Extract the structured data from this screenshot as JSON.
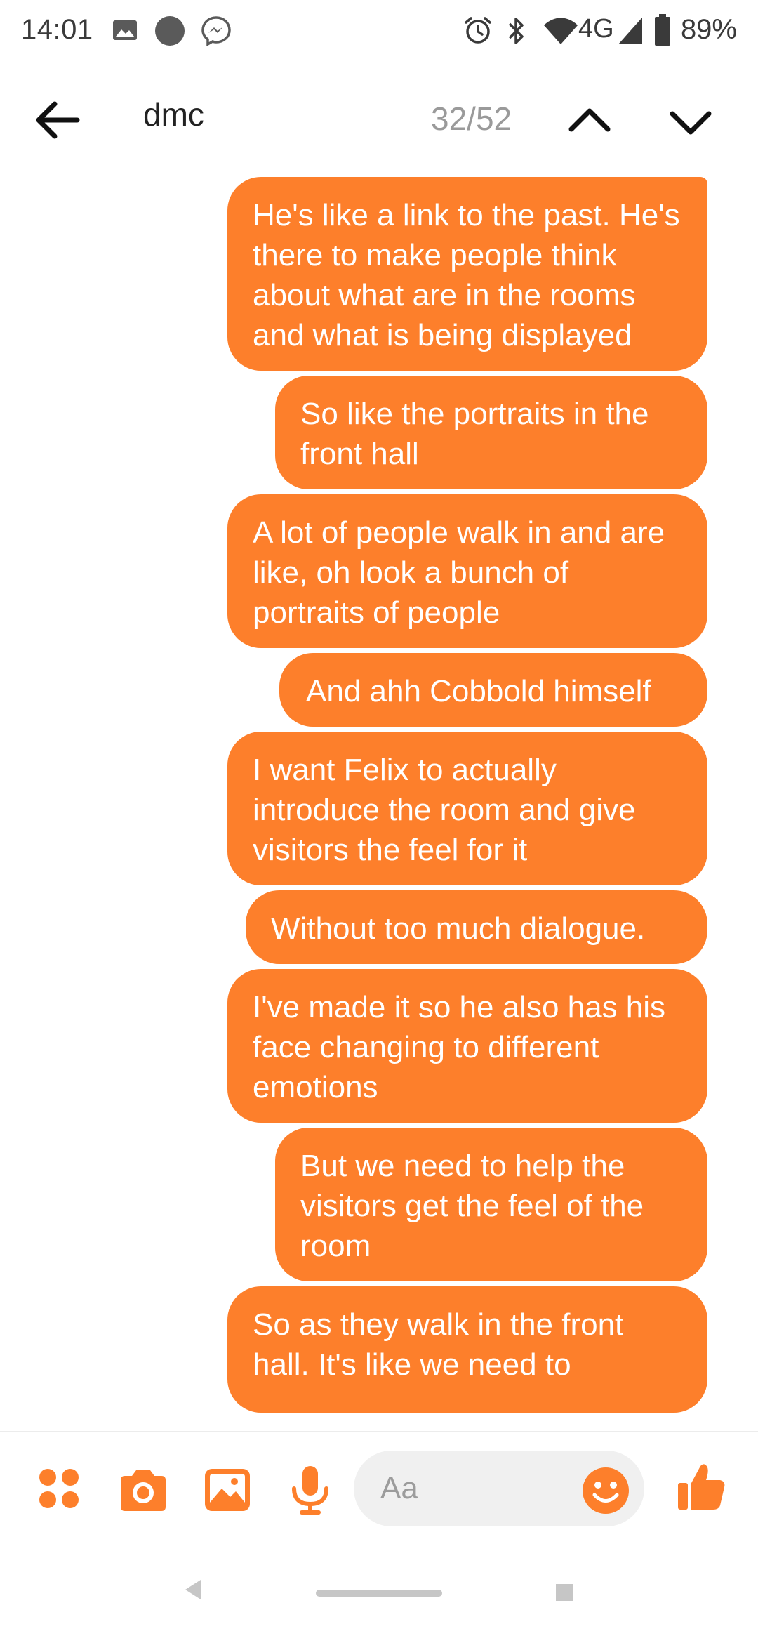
{
  "status_bar": {
    "time": "14:01",
    "network": "4G",
    "battery_percent": "89%",
    "icons": [
      "image-icon",
      "dot-icon",
      "messenger-icon",
      "alarm-icon",
      "bluetooth-icon",
      "wifi-icon",
      "signal-icon",
      "battery-icon"
    ]
  },
  "header": {
    "search_term": "dmc",
    "result_counter": "32/52",
    "icons": [
      "back-arrow-icon",
      "chevron-up-icon",
      "chevron-down-icon"
    ]
  },
  "messages": [
    {
      "text": "He's like a link to the past. He's there to make people think about what are in the rooms and what is being displayed"
    },
    {
      "text": "So like the portraits in the front hall"
    },
    {
      "text": "A lot of people walk in and are like, oh look a bunch of portraits of people"
    },
    {
      "text": "And ahh Cobbold himself"
    },
    {
      "text": "I want Felix to actually introduce the room and give visitors the feel for it"
    },
    {
      "text": "Without too much dialogue."
    },
    {
      "text": "I've made it so he also has his face changing to different emotions"
    },
    {
      "text": "But we need to help the visitors get the feel of the room"
    },
    {
      "text": "So as they walk in the front hall. It's like we need to"
    }
  ],
  "composer": {
    "placeholder": "Aa",
    "icons": [
      "apps-icon",
      "camera-icon",
      "gallery-icon",
      "microphone-icon",
      "emoji-icon",
      "thumbs-up-icon"
    ]
  },
  "nav_bar": {
    "icons": [
      "nav-back-icon",
      "nav-home-pill",
      "nav-recents-icon"
    ]
  },
  "colors": {
    "accent": "#fd7f2b",
    "bubble_text": "#ffffff",
    "counter_text": "#9a9a9a",
    "input_background": "#f0f0f0"
  }
}
